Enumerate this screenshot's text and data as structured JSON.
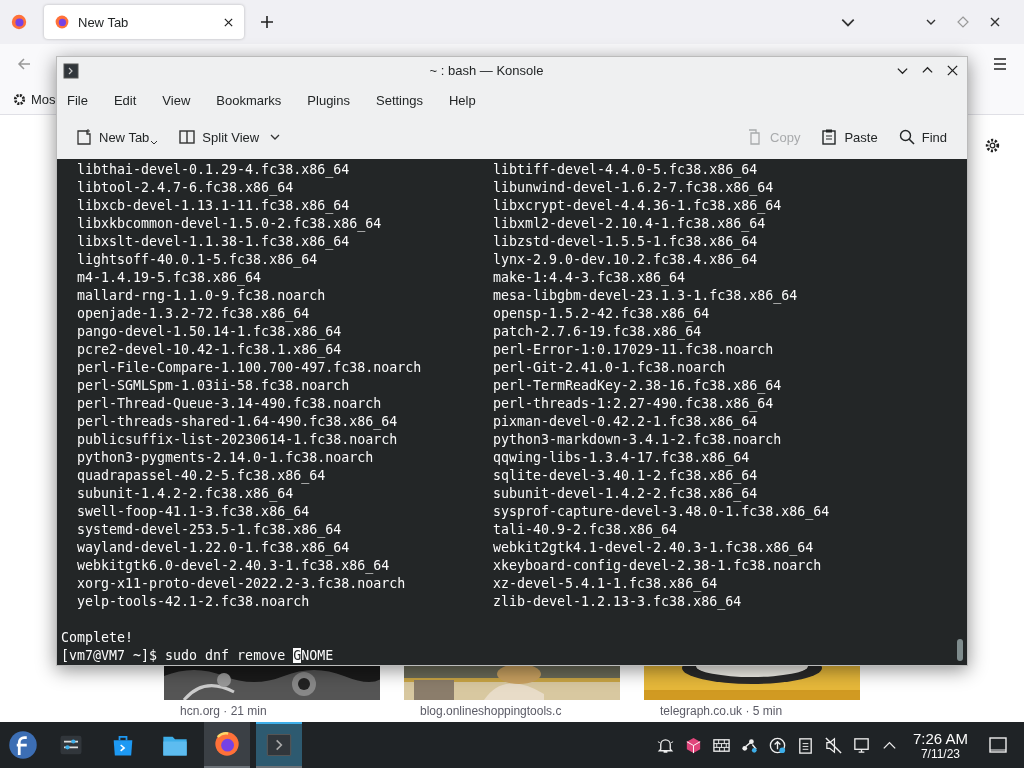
{
  "browser": {
    "tabs": [
      {
        "label": "New Tab",
        "selected": true
      }
    ],
    "bookmark": "Mos",
    "cards": [
      {
        "caption": "hcn.org · 21 min"
      },
      {
        "caption": "blog.onlineshoppingtools.c"
      },
      {
        "caption": "telegraph.co.uk · 5 min"
      }
    ]
  },
  "konsole": {
    "title": "~ : bash — Konsole",
    "menu": [
      "File",
      "Edit",
      "View",
      "Bookmarks",
      "Plugins",
      "Settings",
      "Help"
    ],
    "toolbar_left": [
      {
        "label": "New Tab",
        "kind": "new-tab"
      },
      {
        "label": "Split View",
        "kind": "split"
      }
    ],
    "toolbar_right": [
      {
        "label": "Copy",
        "kind": "copy",
        "disabled": true
      },
      {
        "label": "Paste",
        "kind": "paste",
        "disabled": false
      },
      {
        "label": "Find",
        "kind": "find",
        "disabled": false
      }
    ],
    "packages": [
      [
        "libthai-devel-0.1.29-4.fc38.x86_64",
        "libtiff-devel-4.4.0-5.fc38.x86_64"
      ],
      [
        "libtool-2.4.7-6.fc38.x86_64",
        "libunwind-devel-1.6.2-7.fc38.x86_64"
      ],
      [
        "libxcb-devel-1.13.1-11.fc38.x86_64",
        "libxcrypt-devel-4.4.36-1.fc38.x86_64"
      ],
      [
        "libxkbcommon-devel-1.5.0-2.fc38.x86_64",
        "libxml2-devel-2.10.4-1.fc38.x86_64"
      ],
      [
        "libxslt-devel-1.1.38-1.fc38.x86_64",
        "libzstd-devel-1.5.5-1.fc38.x86_64"
      ],
      [
        "lightsoff-40.0.1-5.fc38.x86_64",
        "lynx-2.9.0-dev.10.2.fc38.4.x86_64"
      ],
      [
        "m4-1.4.19-5.fc38.x86_64",
        "make-1:4.4-3.fc38.x86_64"
      ],
      [
        "mallard-rng-1.1.0-9.fc38.noarch",
        "mesa-libgbm-devel-23.1.3-1.fc38.x86_64"
      ],
      [
        "openjade-1.3.2-72.fc38.x86_64",
        "opensp-1.5.2-42.fc38.x86_64"
      ],
      [
        "pango-devel-1.50.14-1.fc38.x86_64",
        "patch-2.7.6-19.fc38.x86_64"
      ],
      [
        "pcre2-devel-10.42-1.fc38.1.x86_64",
        "perl-Error-1:0.17029-11.fc38.noarch"
      ],
      [
        "perl-File-Compare-1.100.700-497.fc38.noarch",
        "perl-Git-2.41.0-1.fc38.noarch"
      ],
      [
        "perl-SGMLSpm-1.03ii-58.fc38.noarch",
        "perl-TermReadKey-2.38-16.fc38.x86_64"
      ],
      [
        "perl-Thread-Queue-3.14-490.fc38.noarch",
        "perl-threads-1:2.27-490.fc38.x86_64"
      ],
      [
        "perl-threads-shared-1.64-490.fc38.x86_64",
        "pixman-devel-0.42.2-1.fc38.x86_64"
      ],
      [
        "publicsuffix-list-20230614-1.fc38.noarch",
        "python3-markdown-3.4.1-2.fc38.noarch"
      ],
      [
        "python3-pygments-2.14.0-1.fc38.noarch",
        "qqwing-libs-1.3.4-17.fc38.x86_64"
      ],
      [
        "quadrapassel-40.2-5.fc38.x86_64",
        "sqlite-devel-3.40.1-2.fc38.x86_64"
      ],
      [
        "subunit-1.4.2-2.fc38.x86_64",
        "subunit-devel-1.4.2-2.fc38.x86_64"
      ],
      [
        "swell-foop-41.1-3.fc38.x86_64",
        "sysprof-capture-devel-3.48.0-1.fc38.x86_64"
      ],
      [
        "systemd-devel-253.5-1.fc38.x86_64",
        "tali-40.9-2.fc38.x86_64"
      ],
      [
        "wayland-devel-1.22.0-1.fc38.x86_64",
        "webkit2gtk4.1-devel-2.40.3-1.fc38.x86_64"
      ],
      [
        "webkitgtk6.0-devel-2.40.3-1.fc38.x86_64",
        "xkeyboard-config-devel-2.38-1.fc38.noarch"
      ],
      [
        "xorg-x11-proto-devel-2022.2-3.fc38.noarch",
        "xz-devel-5.4.1-1.fc38.x86_64"
      ],
      [
        "yelp-tools-42.1-2.fc38.noarch",
        "zlib-devel-1.2.13-3.fc38.x86_64"
      ]
    ],
    "status": "Complete!",
    "input": {
      "before_cursor": "[vm7@VM7 ~]$ sudo dnf remove ",
      "under_cursor": "G",
      "after_cursor": "NOME"
    }
  },
  "taskbar": {
    "apps": [
      {
        "running": false,
        "active": false
      },
      {
        "running": false,
        "active": false
      },
      {
        "running": false,
        "active": false
      },
      {
        "running": true,
        "active": false
      },
      {
        "running": true,
        "active": true
      }
    ],
    "time": "7:26 AM",
    "date": "7/11/23"
  }
}
